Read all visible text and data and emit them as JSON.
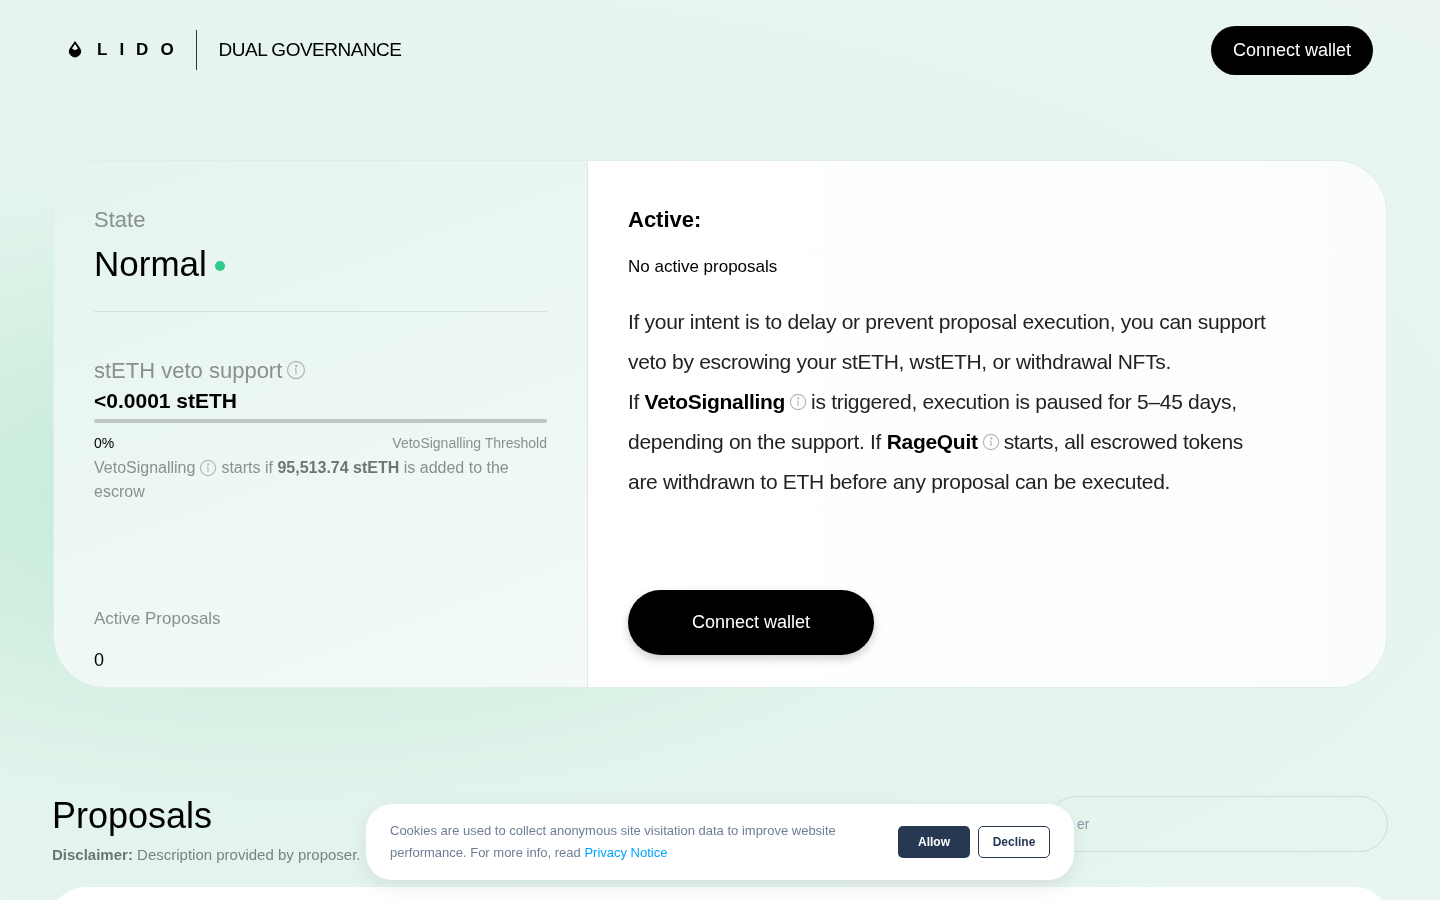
{
  "header": {
    "logo_text": "LIDO",
    "title": "DUAL GOVERNANCE",
    "button": "Connect wallet"
  },
  "state": {
    "label": "State",
    "value": "Normal",
    "color": "#2fcb8c"
  },
  "veto": {
    "label": "stETH veto support",
    "amount": "<0.0001 stETH",
    "level": 0,
    "percent": "0%",
    "threshold": "VetoSignalling Threshold",
    "note_lines": [
      [
        {
          "kind": "text",
          "text": "VetoSignalling"
        },
        {
          "kind": "info"
        },
        {
          "kind": "text",
          "text": "starts if **95,513.74 stETH** is added to the"
        }
      ],
      [
        {
          "kind": "text",
          "text": "escrow"
        }
      ]
    ]
  },
  "active_proposals": {
    "label": "Active Proposals",
    "value": "0"
  },
  "right": {
    "title": "Active:",
    "subtitle": "No active proposals",
    "lines": [
      [
        {
          "kind": "text",
          "text": "If your intent is to delay or prevent proposal execution, you can support"
        }
      ],
      [
        {
          "kind": "text",
          "text": "veto by escrowing your stETH, wstETH, or withdrawal NFTs."
        }
      ],
      [
        {
          "kind": "text",
          "text": "If **VetoSignalling**"
        },
        {
          "kind": "info"
        },
        {
          "kind": "text",
          "text": "is triggered, execution is paused for 5–45 days,"
        }
      ],
      [
        {
          "kind": "text",
          "text": "depending on the support. If **RageQuit**"
        },
        {
          "kind": "info"
        },
        {
          "kind": "text",
          "text": "starts, all escrowed tokens"
        }
      ],
      [
        {
          "kind": "text",
          "text": "are withdrawn to ETH before any proposal can be executed."
        }
      ]
    ],
    "button": "Connect wallet"
  },
  "proposals": {
    "title": "Proposals",
    "disclaimer": "**Disclaimer:** Description provided by proposer.",
    "search_placeholder": "er"
  },
  "cookie_banner": {
    "text": "Cookies are used to collect anonymous site visitation data to improve website performance. For more info, read",
    "link": "Privacy Notice",
    "allow": "Allow",
    "decline": "Decline"
  }
}
